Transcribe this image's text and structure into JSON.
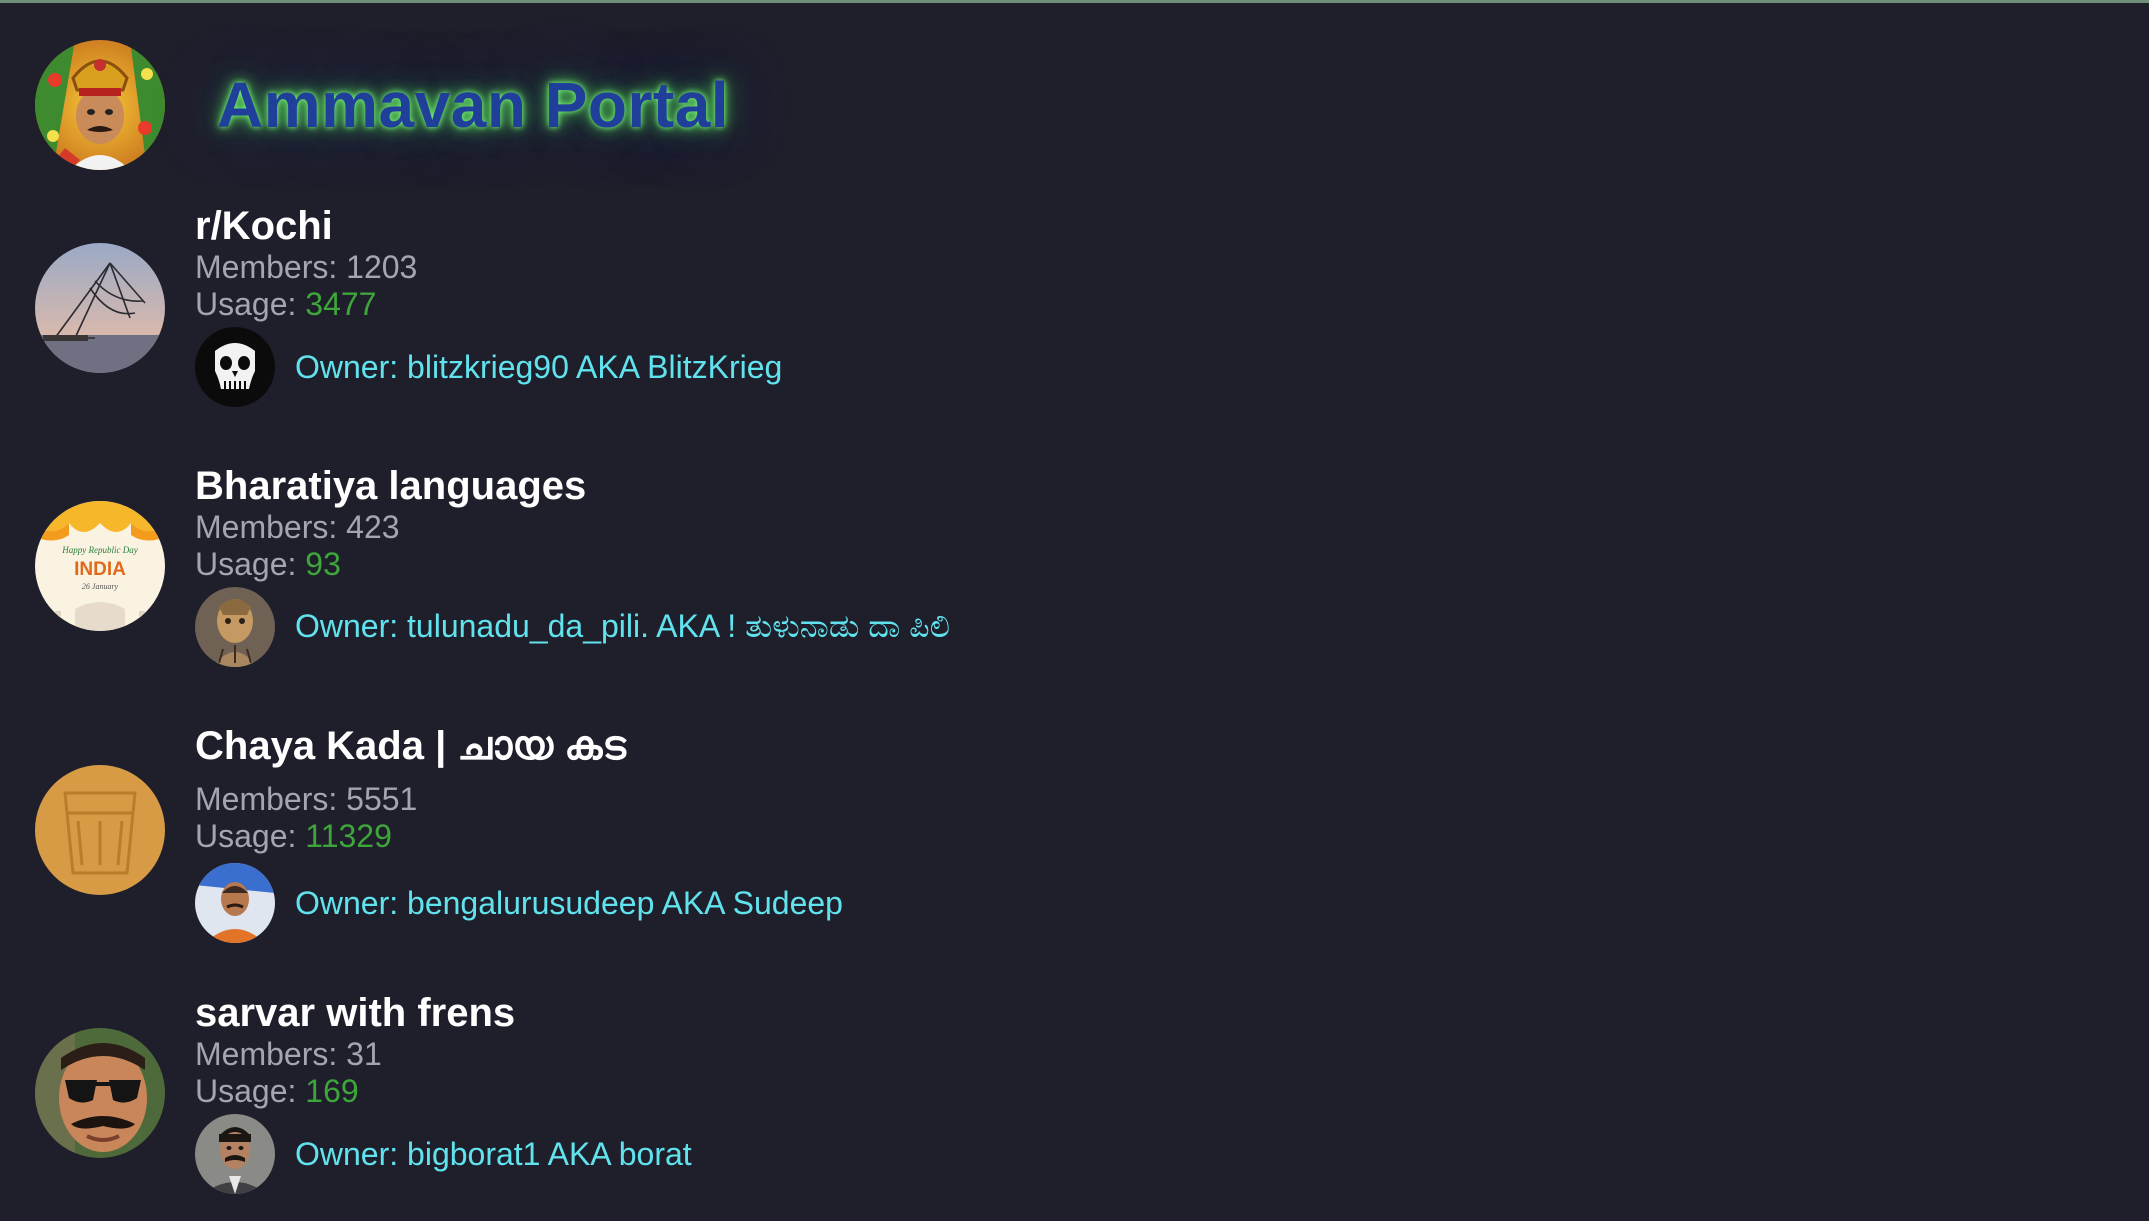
{
  "app": {
    "title": "Ammavan Portal",
    "logo_icon": "kathakali-uncle-avatar-icon",
    "colors": {
      "background": "#1f1f2c",
      "title": "#1f3f9a",
      "title_glow": "#5ad65a",
      "group_name": "#ffffff",
      "stat_label": "#a5a5ad",
      "usage_value": "#3da53a",
      "owner_text": "#61e3ee"
    }
  },
  "groups": [
    {
      "name": "r/Kochi",
      "members_label": "Members: ",
      "members": "1203",
      "usage_label": "Usage: ",
      "usage": "3477",
      "owner": "Owner: blitzkrieg90 AKA BlitzKrieg",
      "avatar_icon": "chinese-fishing-net-icon",
      "owner_avatar_icon": "punisher-skull-icon"
    },
    {
      "name": "Bharatiya languages",
      "members_label": "Members: ",
      "members": "423",
      "usage_label": "Usage: ",
      "usage": "93",
      "owner": "Owner: tulunadu_da_pili. AKA ! ತುಳುನಾಡು ದಾ ಪಿಲಿ",
      "avatar_icon": "republic-day-india-badge-icon",
      "avatar_badge_text": "INDIA",
      "avatar_badge_sub_top": "Happy Republic Day",
      "avatar_badge_sub_bottom": "26 January",
      "owner_avatar_icon": "tiger-dancer-icon"
    },
    {
      "name": "Chaya Kada | ചായ കട",
      "members_label": "Members: ",
      "members": "5551",
      "usage_label": "Usage: ",
      "usage": "11329",
      "owner": "Owner: bengalurusudeep AKA Sudeep",
      "avatar_icon": "tea-glass-icon",
      "owner_avatar_icon": "man-portrait-icon"
    },
    {
      "name": "sarvar with frens",
      "members_label": "Members: ",
      "members": "31",
      "usage_label": "Usage: ",
      "usage": "169",
      "owner": "Owner: bigborat1 AKA borat",
      "avatar_icon": "man-sunglasses-mustache-icon",
      "owner_avatar_icon": "borat-portrait-icon"
    }
  ]
}
